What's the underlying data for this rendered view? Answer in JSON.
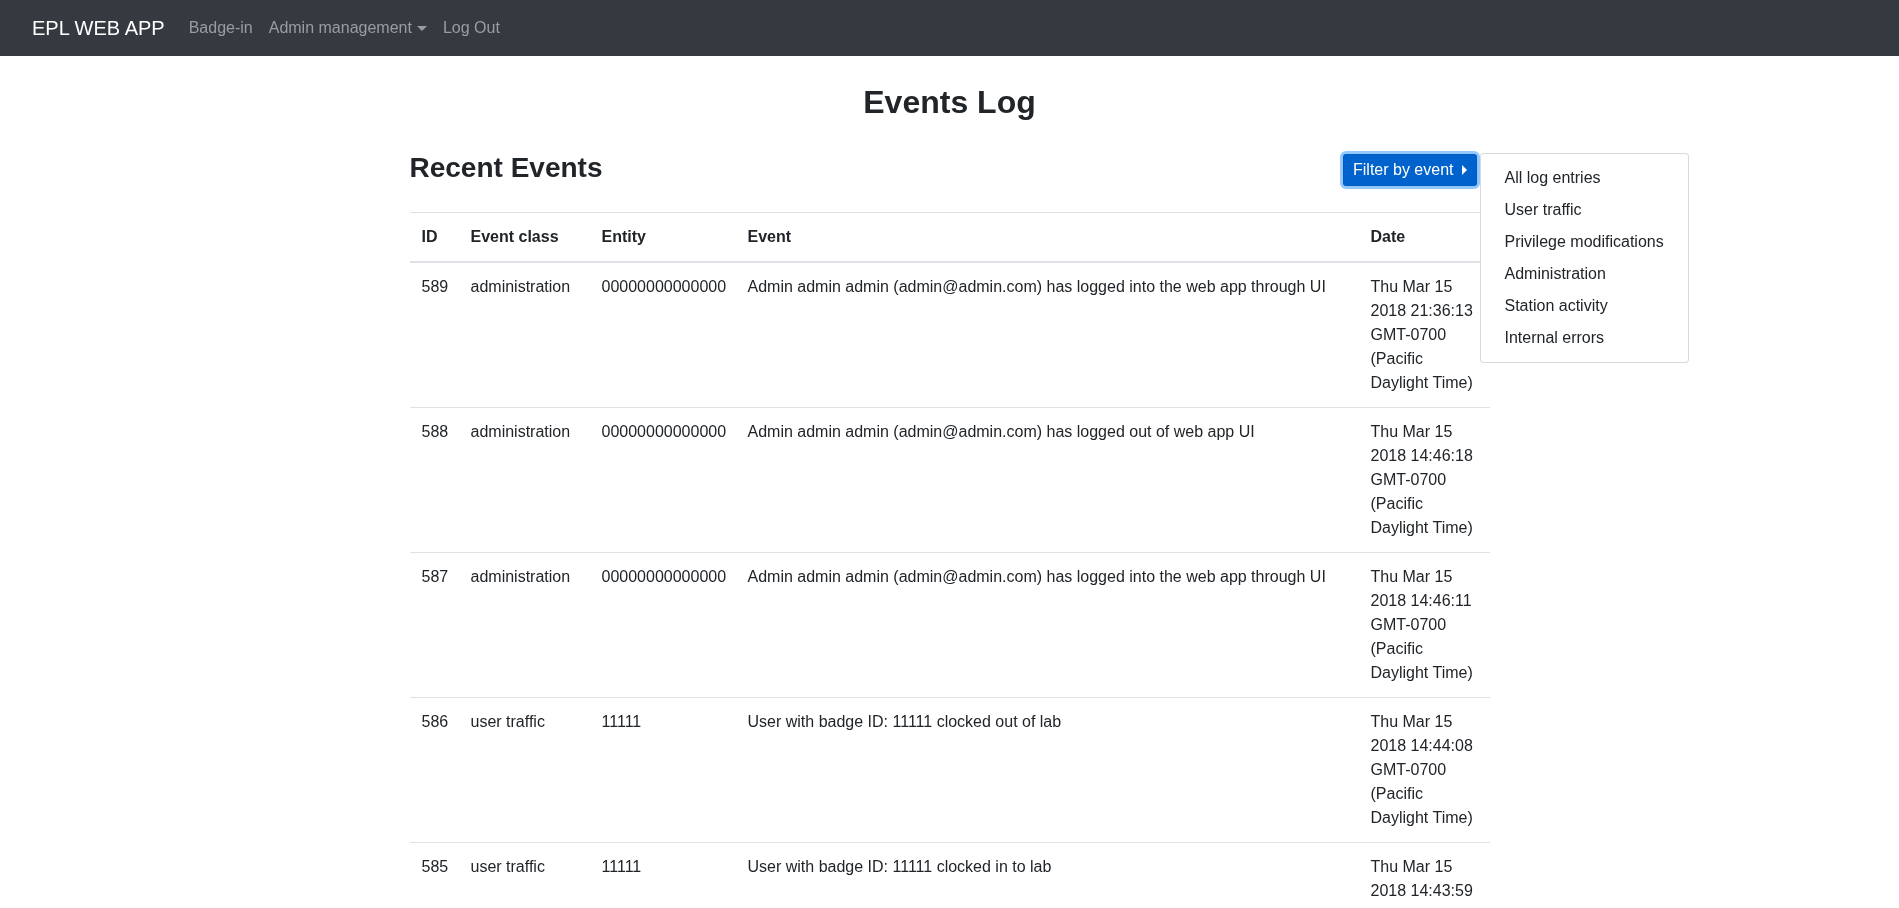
{
  "navbar": {
    "brand": "EPL WEB APP",
    "links": [
      {
        "label": "Badge-in",
        "kind": "link"
      },
      {
        "label": "Admin management",
        "kind": "dropdown"
      },
      {
        "label": "Log Out",
        "kind": "link"
      }
    ]
  },
  "page_title": "Events Log",
  "section_title": "Recent Events",
  "filter": {
    "label": "Filter by event",
    "expanded": true,
    "options": [
      "All log entries",
      "User traffic",
      "Privilege modifications",
      "Administration",
      "Station activity",
      "Internal errors"
    ]
  },
  "table": {
    "columns": [
      "ID",
      "Event class",
      "Entity",
      "Event",
      "Date"
    ],
    "rows": [
      {
        "cells": [
          "589",
          "administration",
          "00000000000000",
          "Admin admin admin (admin@admin.com) has logged into the web app through UI",
          "Thu Mar 15 2018 21:36:13 GMT-0700 (Pacific Daylight Time)"
        ]
      },
      {
        "cells": [
          "588",
          "administration",
          "00000000000000",
          "Admin admin admin (admin@admin.com) has logged out of web app UI",
          "Thu Mar 15 2018 14:46:18 GMT-0700 (Pacific Daylight Time)"
        ]
      },
      {
        "cells": [
          "587",
          "administration",
          "00000000000000",
          "Admin admin admin (admin@admin.com) has logged into the web app through UI",
          "Thu Mar 15 2018 14:46:11 GMT-0700 (Pacific Daylight Time)"
        ]
      },
      {
        "cells": [
          "586",
          "user traffic",
          "11111",
          "User with badge ID: 11111 clocked out of lab",
          "Thu Mar 15 2018 14:44:08 GMT-0700 (Pacific Daylight Time)"
        ]
      },
      {
        "cells": [
          "585",
          "user traffic",
          "11111",
          "User with badge ID: 11111 clocked in to lab",
          "Thu Mar 15 2018 14:43:59"
        ]
      }
    ]
  }
}
